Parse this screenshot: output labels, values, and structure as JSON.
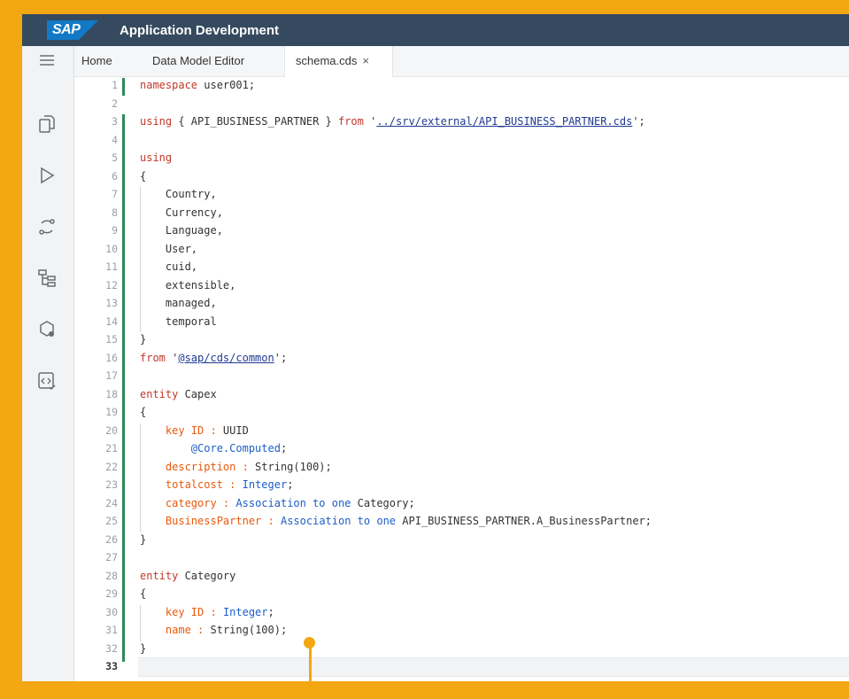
{
  "shellbar": {
    "logo_text": "SAP",
    "title": "Application Development"
  },
  "activity_icons": [
    "menu-icon",
    "explorer-icon",
    "run-icon",
    "source-control-icon",
    "outline-icon",
    "debug-icon",
    "code-icon"
  ],
  "tabs": [
    {
      "label": "Home",
      "active": false
    },
    {
      "label": "Data Model Editor",
      "active": false
    },
    {
      "label": "schema.cds",
      "active": true,
      "close": "×"
    }
  ],
  "editor": {
    "current_line": 33,
    "lines": [
      "namespace user001;",
      "",
      "using { API_BUSINESS_PARTNER } from '../srv/external/API_BUSINESS_PARTNER.cds';",
      "",
      "using",
      "{",
      "    Country,",
      "    Currency,",
      "    Language,",
      "    User,",
      "    cuid,",
      "    extensible,",
      "    managed,",
      "    temporal",
      "}",
      "from '@sap/cds/common';",
      "",
      "entity Capex",
      "{",
      "    key ID : UUID",
      "        @Core.Computed;",
      "    description : String(100);",
      "    totalcost : Integer;",
      "    category : Association to one Category;",
      "    BusinessPartner : Association to one API_BUSINESS_PARTNER.A_BusinessPartner;",
      "}",
      "",
      "entity Category",
      "{",
      "    key ID : Integer;",
      "    name : String(100);",
      "}",
      ""
    ]
  },
  "colors": {
    "highlight": "#f3a712",
    "shellbar": "#354a5f",
    "keyword": "#c0392b",
    "type": "#1c5fc7",
    "property": "#e8590c"
  }
}
